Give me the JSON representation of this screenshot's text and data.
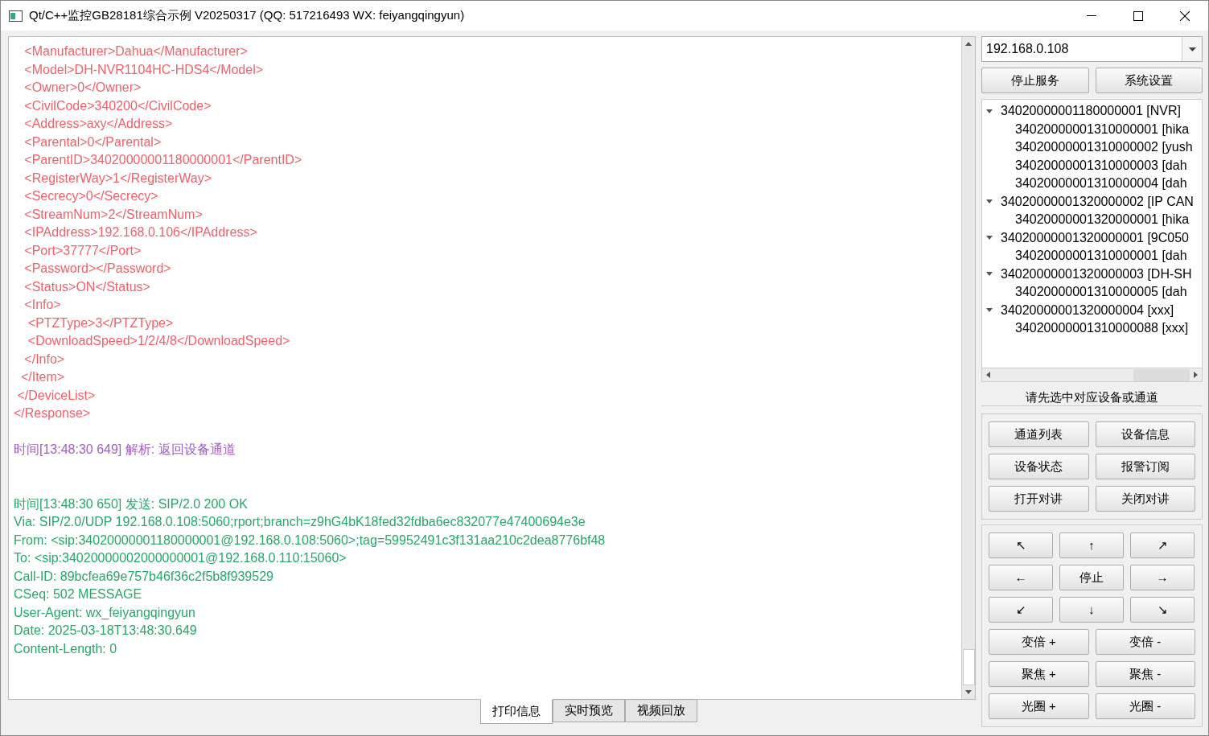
{
  "window": {
    "title": "Qt/C++监控GB28181综合示例 V20250317 (QQ: 517216493 WX: feiyangqingyun)"
  },
  "log": [
    {
      "kind": "xml",
      "lines": [
        "   <Manufacturer>Dahua</Manufacturer>",
        "   <Model>DH-NVR1104HC-HDS4</Model>",
        "   <Owner>0</Owner>",
        "   <CivilCode>340200</CivilCode>",
        "   <Address>axy</Address>",
        "   <Parental>0</Parental>",
        "   <ParentID>34020000001180000001</ParentID>",
        "   <RegisterWay>1</RegisterWay>",
        "   <Secrecy>0</Secrecy>",
        "   <StreamNum>2</StreamNum>",
        "   <IPAddress>192.168.0.106</IPAddress>",
        "   <Port>37777</Port>",
        "   <Password></Password>",
        "   <Status>ON</Status>",
        "   <Info>",
        "    <PTZType>3</PTZType>",
        "    <DownloadSpeed>1/2/4/8</DownloadSpeed>",
        "   </Info>",
        "  </Item>",
        " </DeviceList>",
        "</Response>"
      ]
    },
    {
      "kind": "info",
      "lines": [
        "时间[13:48:30 649] 解析: 返回设备通道"
      ]
    },
    {
      "kind": "sip",
      "lines": [
        "时间[13:48:30 650] 发送: SIP/2.0 200 OK",
        "Via: SIP/2.0/UDP 192.168.0.108:5060;rport;branch=z9hG4bK18fed32fdba6ec832077e47400694e3e",
        "From: <sip:34020000001180000001@192.168.0.108:5060>;tag=59952491c3f131aa210c2dea8776bf48",
        "To: <sip:34020000002000000001@192.168.0.110:15060>",
        "Call-ID: 89bcfea69e757b46f36c2f5b8f939529",
        "CSeq: 502 MESSAGE",
        "User-Agent: wx_feiyangqingyun",
        "Date: 2025-03-18T13:48:30.649",
        "Content-Length: 0"
      ]
    }
  ],
  "bottom_tabs": [
    {
      "label": "打印信息",
      "selected": true
    },
    {
      "label": "实时预览",
      "selected": false
    },
    {
      "label": "视频回放",
      "selected": false
    }
  ],
  "server_select": {
    "value": "192.168.0.108"
  },
  "server_buttons": [
    "停止服务",
    "系统设置"
  ],
  "device_tree": [
    {
      "label": "34020000001180000001 [NVR]",
      "expanded": true,
      "children": [
        {
          "label": "34020000001310000001 [hika"
        },
        {
          "label": "34020000001310000002 [yush"
        },
        {
          "label": "34020000001310000003 [dah"
        },
        {
          "label": "34020000001310000004 [dah"
        }
      ]
    },
    {
      "label": "34020000001320000002 [IP CAN",
      "expanded": true,
      "children": [
        {
          "label": "34020000001320000001 [hika"
        }
      ]
    },
    {
      "label": "34020000001320000001 [9C050",
      "expanded": true,
      "children": [
        {
          "label": "34020000001310000001 [dah"
        }
      ]
    },
    {
      "label": "34020000001320000003 [DH-SH",
      "expanded": true,
      "children": [
        {
          "label": "34020000001310000005 [dah"
        }
      ]
    },
    {
      "label": "34020000001320000004 [xxx]",
      "expanded": true,
      "children": [
        {
          "label": "34020000001310000088 [xxx]"
        }
      ]
    }
  ],
  "hint": "请先选中对应设备或通道",
  "device_buttons": [
    "通道列表",
    "设备信息",
    "设备状态",
    "报警订阅",
    "打开对讲",
    "关闭对讲"
  ],
  "ptz_buttons": [
    "↖",
    "↑",
    "↗",
    "←",
    "停止",
    "→",
    "↙",
    "↓",
    "↘"
  ],
  "lens_buttons": [
    "变倍 +",
    "变倍 -",
    "聚焦 +",
    "聚焦 -",
    "光圈 +",
    "光圈 -"
  ]
}
